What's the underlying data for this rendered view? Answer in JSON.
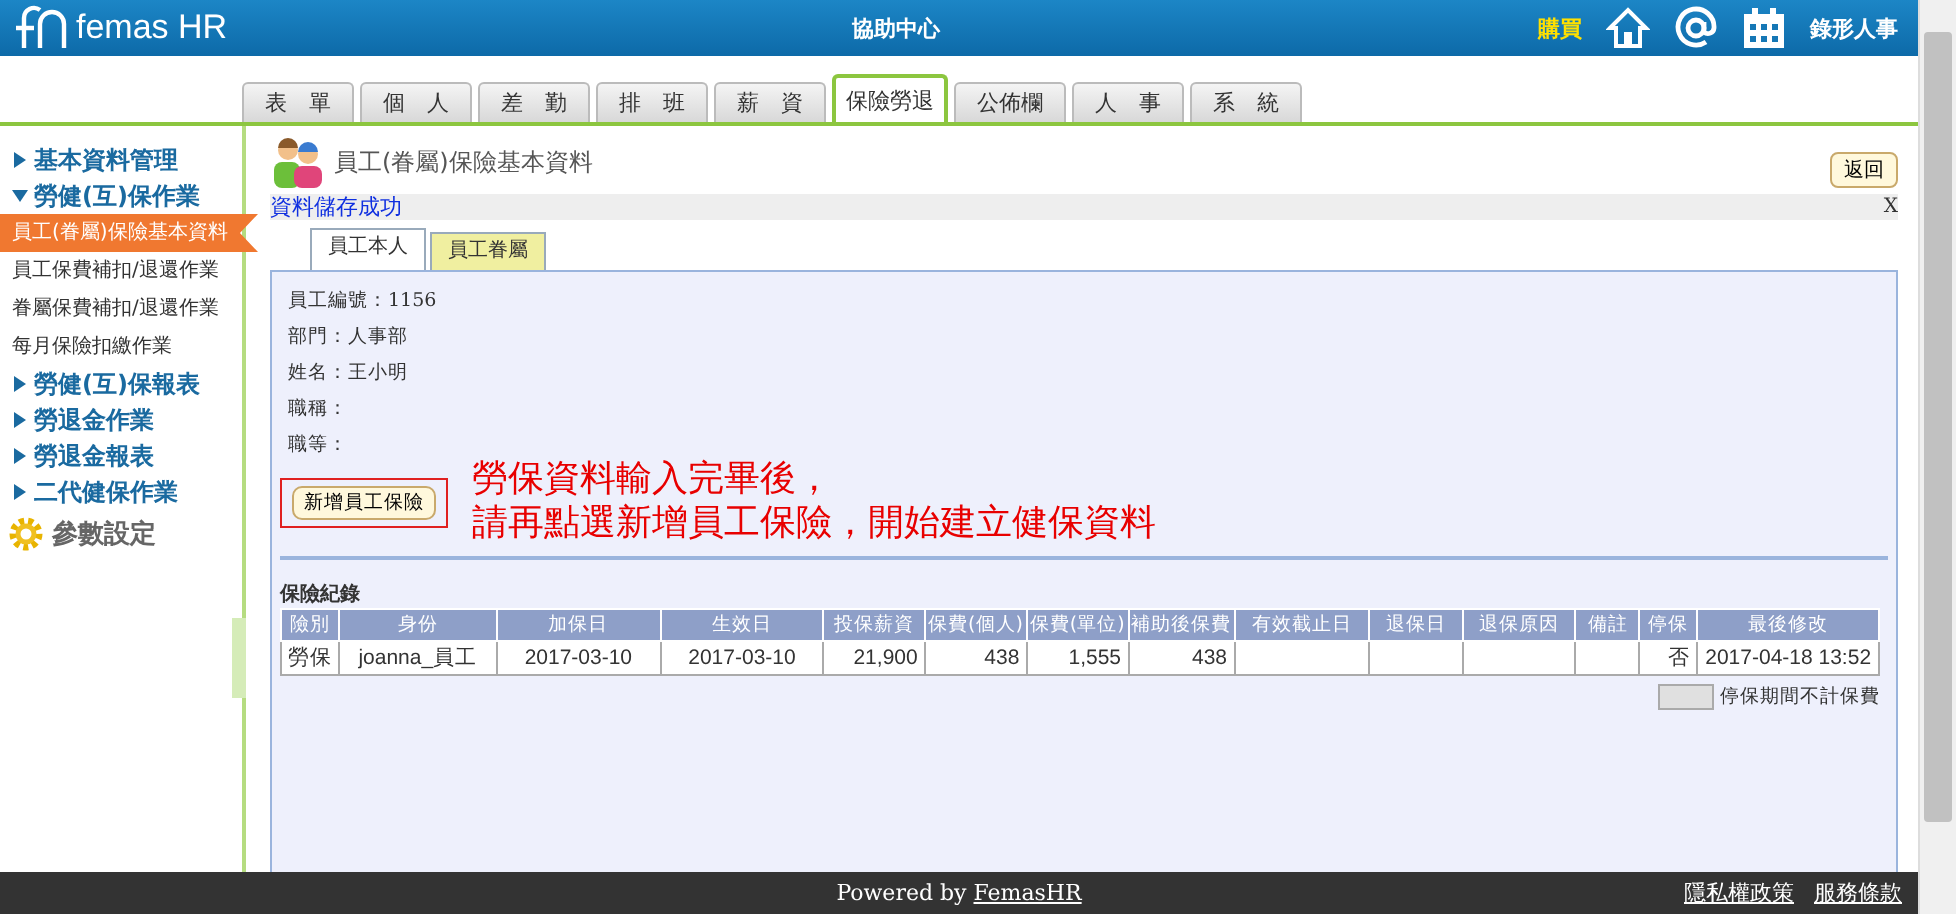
{
  "header": {
    "logo": "femas HR",
    "center_link": "協助中心",
    "buy_link": "購買",
    "user": "錄形人事"
  },
  "tabs": [
    {
      "label": "表　單",
      "selected": false
    },
    {
      "label": "個　人",
      "selected": false
    },
    {
      "label": "差　勤",
      "selected": false
    },
    {
      "label": "排　班",
      "selected": false
    },
    {
      "label": "薪　資",
      "selected": false
    },
    {
      "label": "保險勞退",
      "selected": true
    },
    {
      "label": "公佈欄",
      "selected": false
    },
    {
      "label": "人　事",
      "selected": false
    },
    {
      "label": "系　統",
      "selected": false
    }
  ],
  "sidebar": {
    "items": [
      {
        "kind": "group",
        "label": "基本資料管理",
        "expanded": false
      },
      {
        "kind": "group",
        "label": "勞健(互)保作業",
        "expanded": true,
        "children": [
          {
            "label": "員工(眷屬)保險基本資料",
            "selected": true
          },
          {
            "label": "員工保費補扣/退還作業",
            "selected": false
          },
          {
            "label": "眷屬保費補扣/退還作業",
            "selected": false
          },
          {
            "label": "每月保險扣繳作業",
            "selected": false
          }
        ]
      },
      {
        "kind": "group",
        "label": "勞健(互)保報表",
        "expanded": false
      },
      {
        "kind": "group",
        "label": "勞退金作業",
        "expanded": false
      },
      {
        "kind": "group",
        "label": "勞退金報表",
        "expanded": false
      },
      {
        "kind": "group",
        "label": "二代健保作業",
        "expanded": false
      },
      {
        "kind": "settings",
        "label": "參數設定"
      }
    ]
  },
  "page": {
    "title": "員工(眷屬)保險基本資料",
    "back_button": "返回",
    "message": "資料儲存成功",
    "close": "X",
    "subtabs": [
      {
        "label": "員工本人",
        "selected": true
      },
      {
        "label": "員工眷屬",
        "selected": false
      }
    ],
    "fields": [
      {
        "label": "員工編號：",
        "value": "1156"
      },
      {
        "label": "部門：",
        "value": "人事部"
      },
      {
        "label": "姓名：",
        "value": "王小明"
      },
      {
        "label": "職稱："
      },
      {
        "label": "職等："
      }
    ],
    "add_button": "新增員工保險",
    "annotation": [
      "勞保資料輸入完畢後，",
      "請再點選新增員工保險，開始建立健保資料"
    ],
    "records": {
      "title": "保險紀錄",
      "columns": [
        "險別",
        "身份",
        "加保日",
        "生效日",
        "投保薪資",
        "保費(個人)",
        "保費(單位)",
        "補助後保費",
        "有效截止日",
        "退保日",
        "退保原因",
        "備註",
        "停保",
        "最後修改"
      ],
      "rows": [
        [
          "勞保",
          "joanna_員工",
          "2017-03-10",
          "2017-03-10",
          "21,900",
          "438",
          "1,555",
          "438",
          "",
          "",
          "",
          "",
          "否",
          "2017-04-18 13:52"
        ]
      ],
      "legend": "停保期間不計保費"
    }
  },
  "footer": {
    "powered": "Powered by",
    "brand": "FemasHR",
    "links": [
      "隱私權政策",
      "服務條款"
    ]
  }
}
